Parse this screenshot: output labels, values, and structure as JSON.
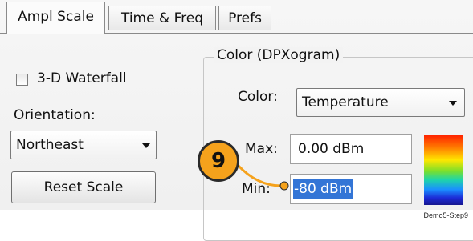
{
  "tabs": [
    {
      "label": "Ampl Scale",
      "active": true
    },
    {
      "label": "Time & Freq",
      "active": false
    },
    {
      "label": "Prefs",
      "active": false
    }
  ],
  "left": {
    "waterfall": {
      "label": "3-D Waterfall",
      "checked": false
    },
    "orientation_label": "Orientation:",
    "orientation_value": "Northeast",
    "reset_button": "Reset Scale"
  },
  "color_group": {
    "title": "Color (DPXogram)",
    "color_label": "Color:",
    "color_value": "Temperature",
    "max_label": "Max:",
    "max_value": "0.00 dBm",
    "min_label": "Min:",
    "min_value": "-80 dBm"
  },
  "callout": {
    "number": "9",
    "color": "#f5a21c"
  },
  "caption": "Demo5-Step9"
}
